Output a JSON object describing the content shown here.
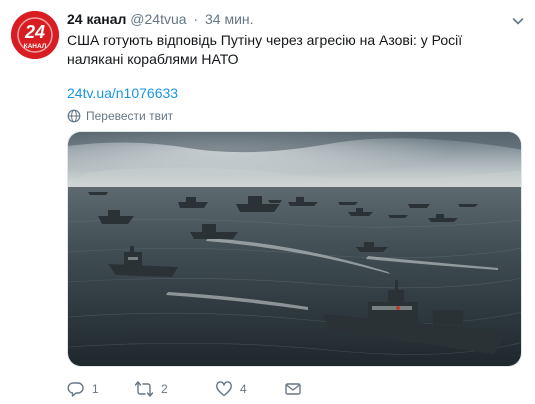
{
  "tweet": {
    "author_name": "24 канал",
    "handle": "@24tvua",
    "separator": "·",
    "time": "34 мин.",
    "text": "США готують відповідь Путіну через агресію на Азові: у Росії налякані кораблями НАТО",
    "link": "24tv.ua/n1076633",
    "translate_label": "Перевести твит",
    "avatar": {
      "badge_number": "24",
      "badge_text": "КАНАЛ",
      "color": "#d81e22"
    },
    "colors": {
      "link": "#1b95e0",
      "muted": "#657786",
      "text": "#14171a"
    },
    "actions": {
      "reply": {
        "icon": "reply-icon",
        "count": "1"
      },
      "retweet": {
        "icon": "retweet-icon",
        "count": "2"
      },
      "like": {
        "icon": "heart-icon",
        "count": "4"
      },
      "message": {
        "icon": "envelope-icon"
      }
    }
  }
}
